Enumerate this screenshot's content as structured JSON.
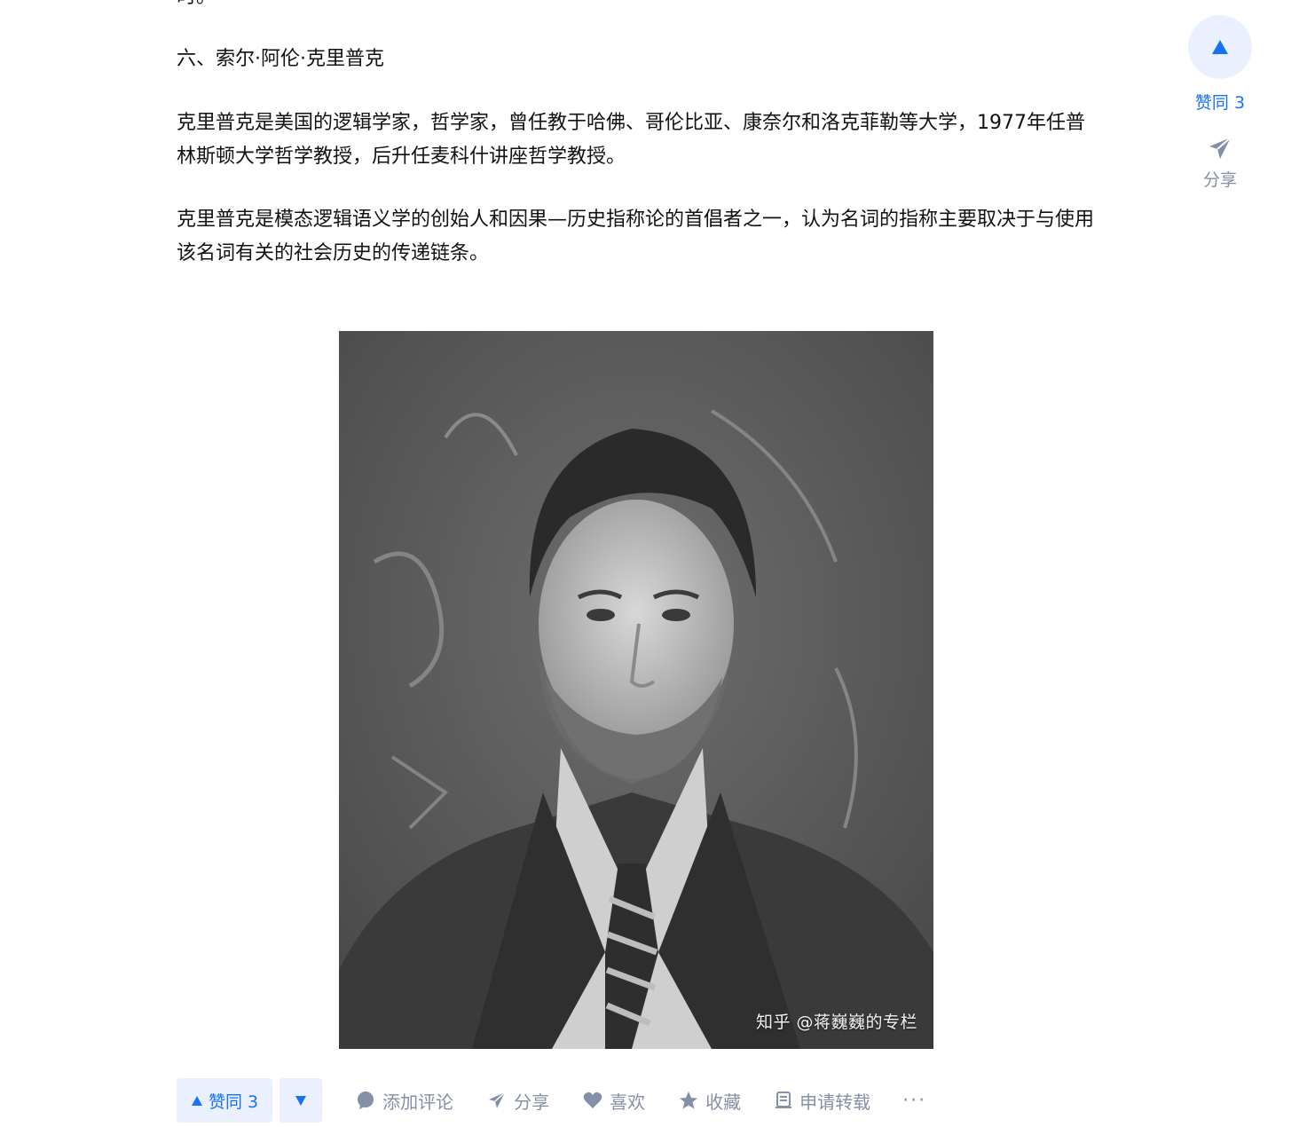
{
  "article": {
    "cut_text": "时。",
    "heading": "六、索尔·阿伦·克里普克",
    "paragraph1": "克里普克是美国的逻辑学家，哲学家，曾任教于哈佛、哥伦比亚、康奈尔和洛克菲勒等大学，1977年任普林斯顿大学哲学教授，后升任麦科什讲座哲学教授。",
    "paragraph2": "克里普克是模态逻辑语义学的创始人和因果—历史指称论的首倡者之一，认为名词的指称主要取决于与使用该名词有关的社会历史的传递链条。",
    "image_watermark": "知乎 @蒋巍巍的专栏"
  },
  "side_bar": {
    "upvote_label": "赞同 3",
    "share_label": "分享"
  },
  "action_bar": {
    "upvote_label": "赞同 3",
    "comment_label": "添加评论",
    "share_label": "分享",
    "like_label": "喜欢",
    "collect_label": "收藏",
    "reprint_label": "申请转载",
    "more_label": "···"
  },
  "colors": {
    "accent": "#1772f6",
    "accent_bg": "#eaf0fd",
    "muted": "#8590a6",
    "text": "#121212"
  }
}
